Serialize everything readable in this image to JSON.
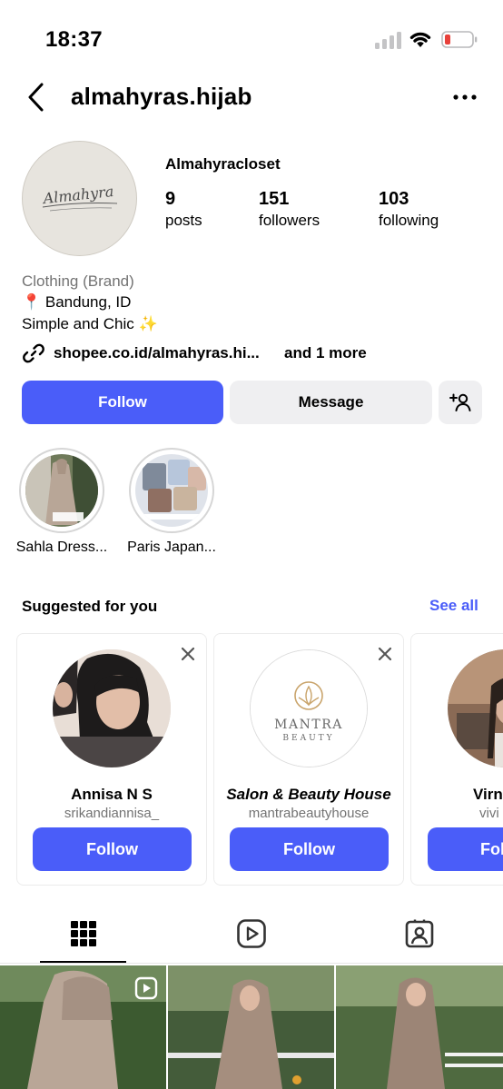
{
  "status_bar": {
    "time": "18:37"
  },
  "header": {
    "username": "almahyras.hijab"
  },
  "profile": {
    "display_name": "Almahyracloset",
    "avatar_text": "Almahyra",
    "stats": [
      {
        "value": "9",
        "label": "posts"
      },
      {
        "value": "151",
        "label": "followers"
      },
      {
        "value": "103",
        "label": "following"
      }
    ],
    "category": "Clothing (Brand)",
    "location": "📍 Bandung, ID",
    "description": "Simple and Chic ✨",
    "link": "shopee.co.id/almahyras.hi...",
    "link_more": "and 1 more"
  },
  "actions": {
    "follow": "Follow",
    "message": "Message"
  },
  "highlights": [
    {
      "label": "Sahla Dress..."
    },
    {
      "label": "Paris Japan..."
    }
  ],
  "suggested": {
    "title": "Suggested for you",
    "see_all": "See all",
    "cards": [
      {
        "name": "Annisa N S",
        "handle": "srikandiannisa_",
        "button": "Follow"
      },
      {
        "name": "Salon & Beauty House",
        "handle": "mantrabeautyhouse",
        "button": "Follow",
        "logo_line1": "MANTRA",
        "logo_line2": "BEAUTY"
      },
      {
        "name": "Virn",
        "handle": "vivi",
        "button": "Foll"
      }
    ]
  },
  "tabs": [
    "grid-icon",
    "reels-icon",
    "tagged-icon"
  ],
  "colors": {
    "accent": "#4a5df9",
    "button_gray": "#efeff1",
    "muted_text": "#737373"
  }
}
